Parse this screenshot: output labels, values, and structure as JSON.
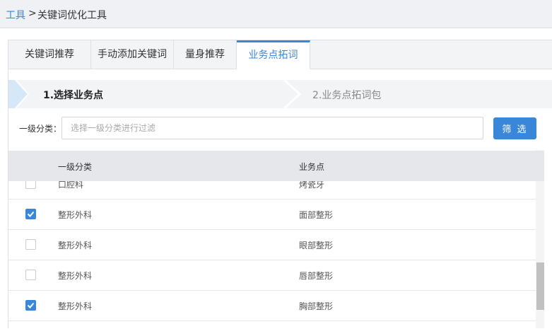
{
  "breadcrumb": {
    "root": "工具",
    "separator": ">",
    "current": "关键词优化工具"
  },
  "tabs": [
    {
      "label": "关键词推荐",
      "active": false
    },
    {
      "label": "手动添加关键词",
      "active": false
    },
    {
      "label": "量身推荐",
      "active": false
    },
    {
      "label": "业务点拓词",
      "active": true
    }
  ],
  "steps": [
    {
      "label": "1.选择业务点",
      "active": true
    },
    {
      "label": "2.业务点拓词包",
      "active": false
    }
  ],
  "filter": {
    "label": "一级分类：",
    "placeholder": "选择一级分类进行过滤",
    "value": "",
    "button": "筛 选"
  },
  "table": {
    "headers": {
      "category": "一级分类",
      "business": "业务点"
    },
    "rows": [
      {
        "category": "口腔科",
        "business": "烤瓷牙",
        "checked": false
      },
      {
        "category": "整形外科",
        "business": "面部整形",
        "checked": true
      },
      {
        "category": "整形外科",
        "business": "眼部整形",
        "checked": false
      },
      {
        "category": "整形外科",
        "business": "唇部整形",
        "checked": false
      },
      {
        "category": "整形外科",
        "business": "胸部整形",
        "checked": true
      }
    ]
  },
  "colors": {
    "accent": "#3a86d8",
    "header_bg": "#eff1f4",
    "table_header_bg": "#e5e7ea"
  }
}
